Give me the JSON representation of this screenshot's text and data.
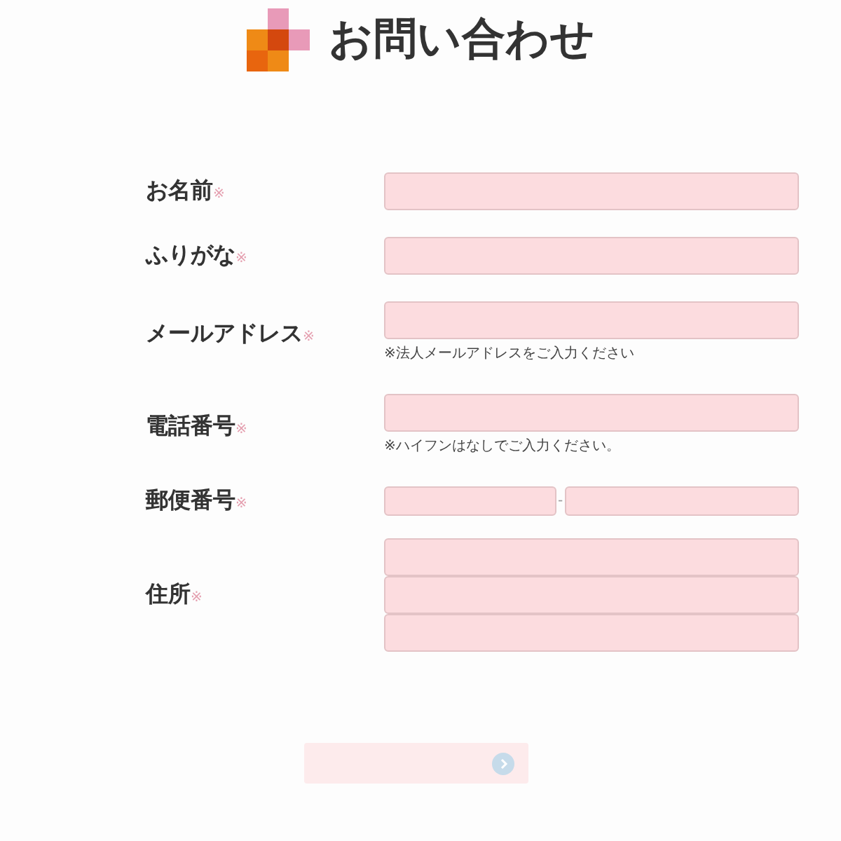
{
  "header": {
    "title": "お問い合わせ"
  },
  "rows": [
    {
      "label": "お名前",
      "required_mark": "※",
      "kind": "single"
    },
    {
      "label": "ふりがな",
      "required_mark": "※",
      "kind": "single"
    },
    {
      "label": "メールアドレス",
      "required_mark": "※",
      "kind": "single",
      "note": "※法人メールアドレスをご入力ください"
    },
    {
      "label": "電話番号",
      "required_mark": "※",
      "kind": "single",
      "note": "※ハイフンはなしでご入力ください。"
    },
    {
      "label": "郵便番号",
      "required_mark": "※",
      "kind": "postal",
      "separator": "-"
    },
    {
      "label": "住所",
      "required_mark": "※",
      "kind": "address"
    }
  ],
  "submit": {
    "disabled": true
  }
}
